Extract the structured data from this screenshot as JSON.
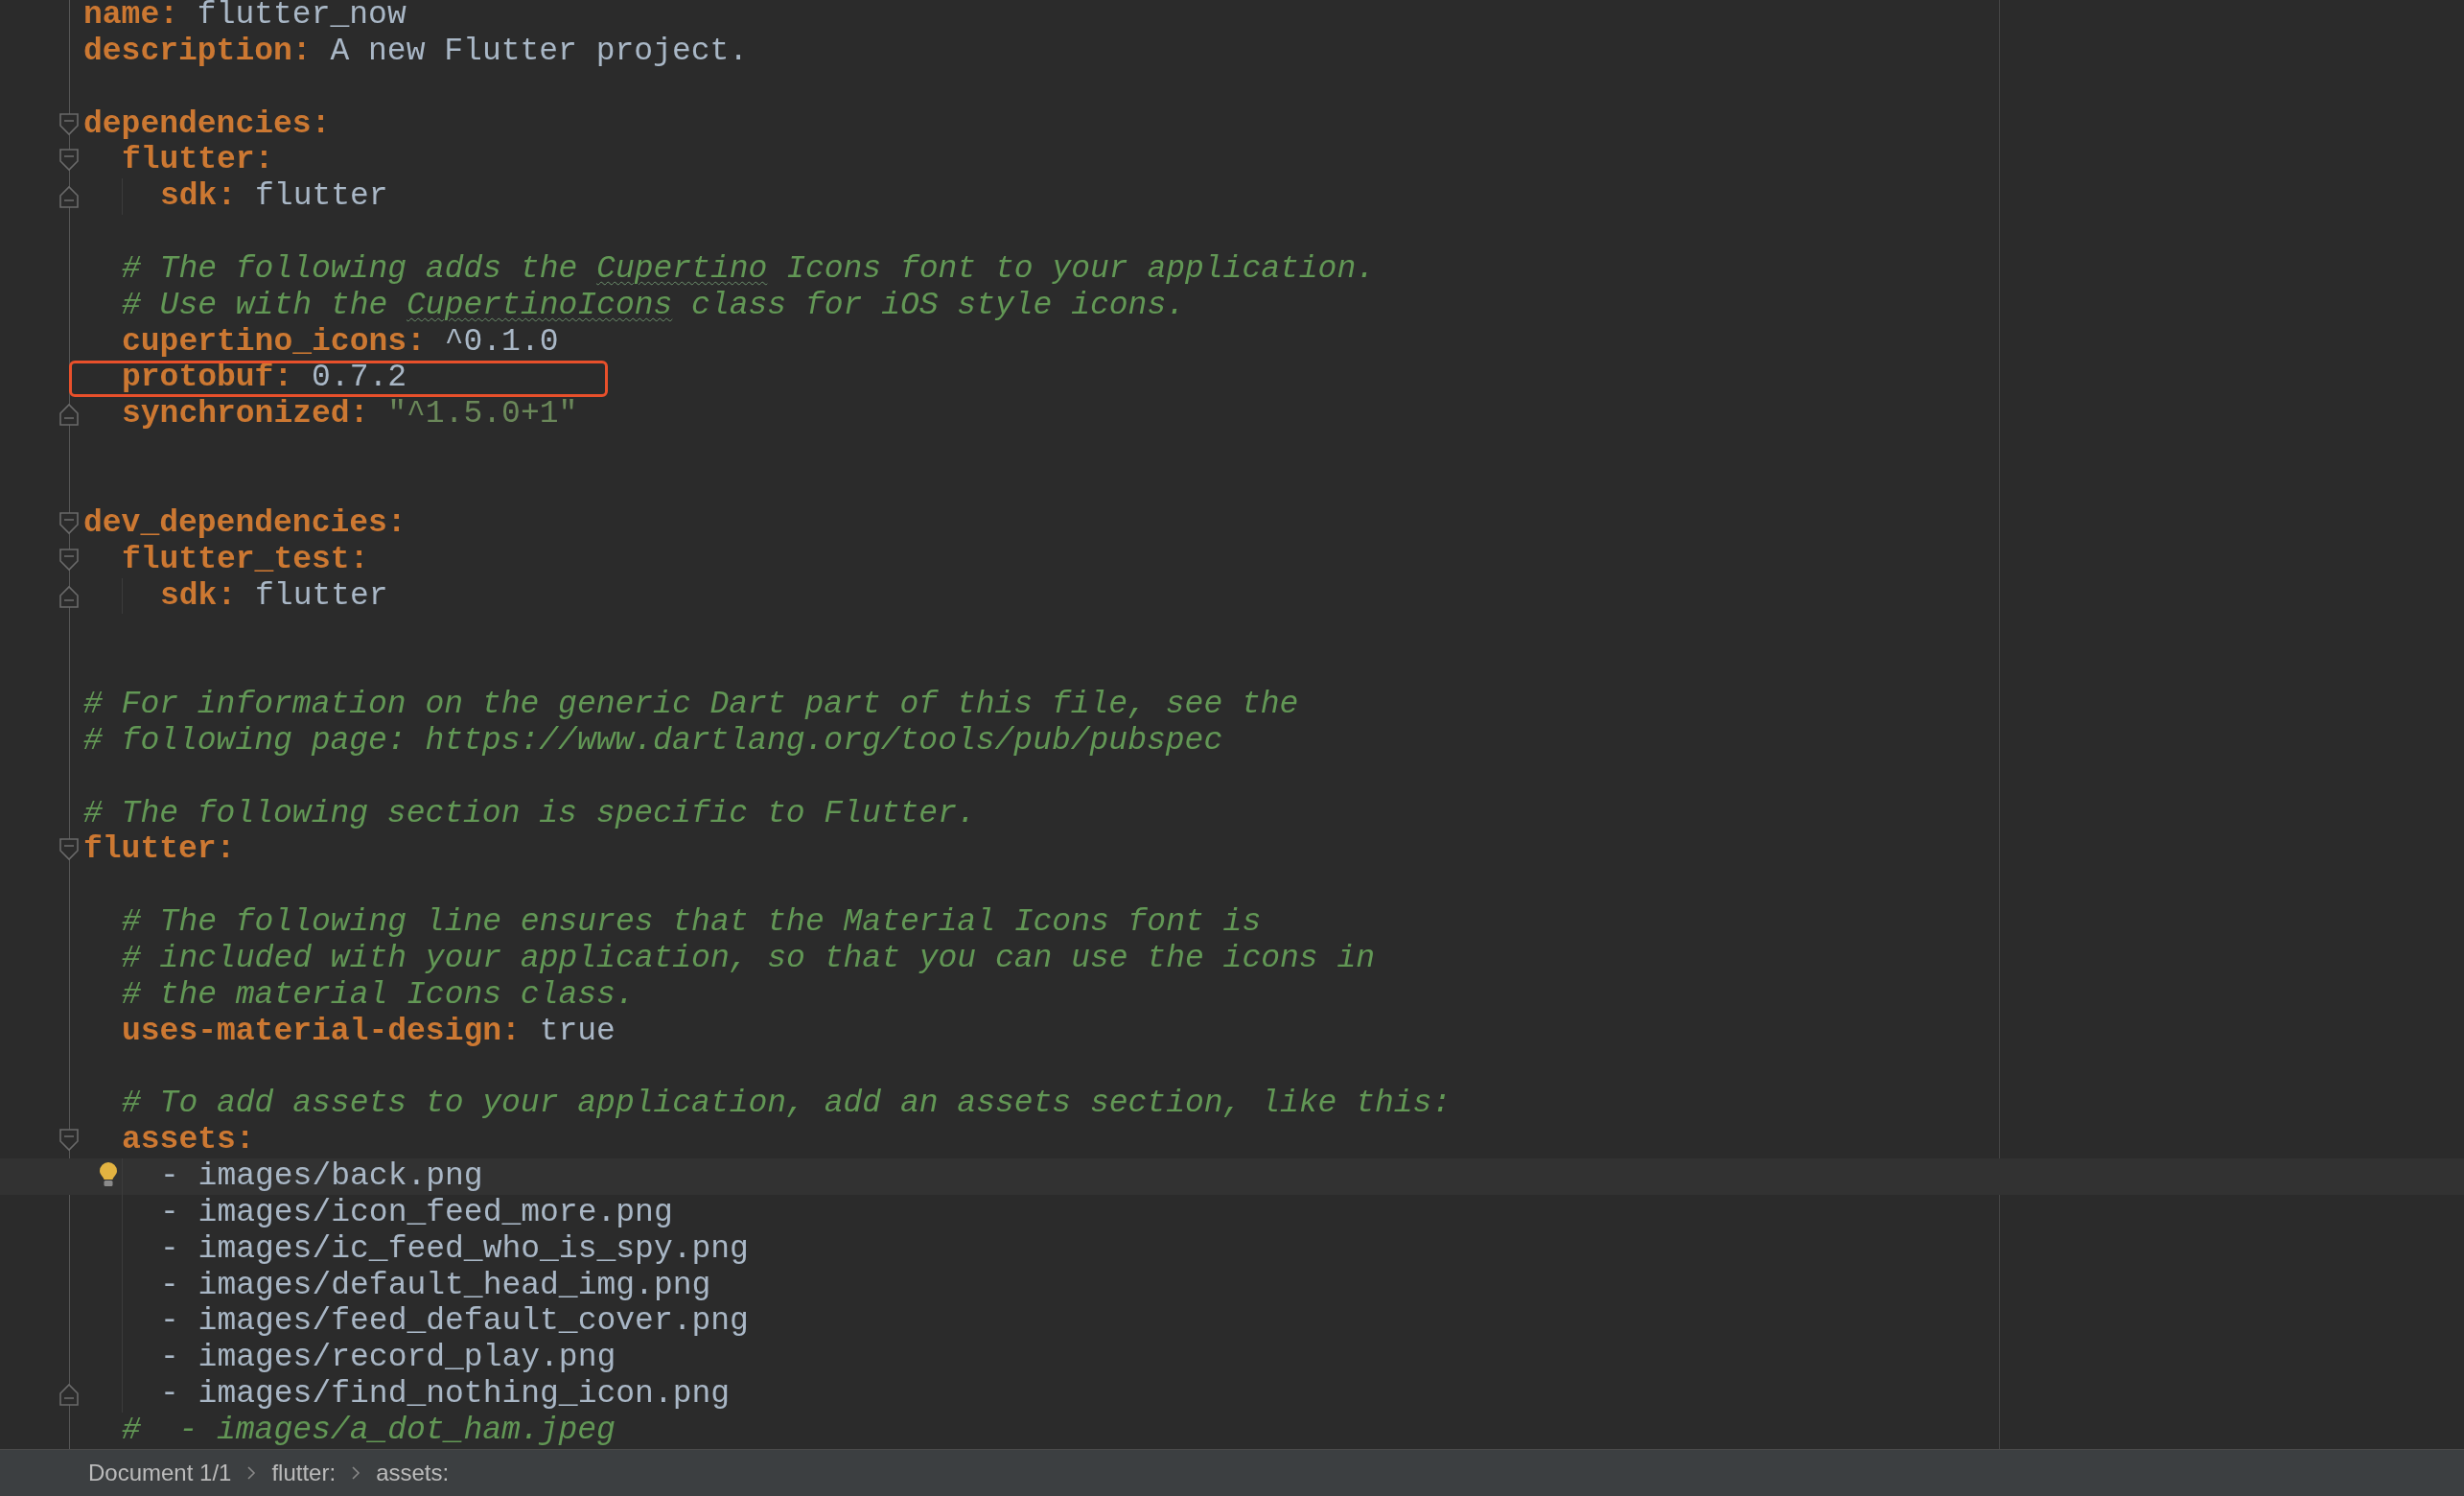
{
  "editor": {
    "lines": [
      {
        "kind": "pair",
        "key": "name:",
        "value": "flutter_now",
        "quoted": false
      },
      {
        "kind": "pair",
        "key": "description:",
        "value": "A new Flutter project.",
        "quoted": false
      },
      {
        "kind": "blank"
      },
      {
        "kind": "pair",
        "key": "dependencies:",
        "fold_start": true,
        "children": [
          {
            "kind": "pair",
            "key": "flutter:",
            "fold_start": true,
            "children": [
              {
                "kind": "pair",
                "key": "sdk:",
                "value": "flutter",
                "quoted": false,
                "fold_end": true
              }
            ]
          },
          {
            "kind": "blank"
          },
          {
            "kind": "comment",
            "segments": [
              {
                "text": "# The following adds the ",
                "typo": false
              },
              {
                "text": "Cupertino",
                "typo": true
              },
              {
                "text": " Icons font to your application.",
                "typo": false
              }
            ]
          },
          {
            "kind": "comment",
            "segments": [
              {
                "text": "# Use with the ",
                "typo": false
              },
              {
                "text": "CupertinoIcons",
                "typo": true
              },
              {
                "text": " class for iOS style icons.",
                "typo": false
              }
            ]
          },
          {
            "kind": "pair",
            "key": "cupertino_icons:",
            "value": "^0.1.0",
            "quoted": false
          },
          {
            "kind": "pair",
            "key": "protobuf:",
            "value": "0.7.2",
            "quoted": false,
            "highlighted": true
          },
          {
            "kind": "pair",
            "key": "synchronized:",
            "value": "\"^1.5.0+1\"",
            "quoted": true,
            "fold_end": true
          }
        ]
      },
      {
        "kind": "blank"
      },
      {
        "kind": "blank"
      },
      {
        "kind": "pair",
        "key": "dev_dependencies:",
        "fold_start": true,
        "children": [
          {
            "kind": "pair",
            "key": "flutter_test:",
            "fold_start": true,
            "children": [
              {
                "kind": "pair",
                "key": "sdk:",
                "value": "flutter",
                "quoted": false,
                "fold_end": true
              }
            ]
          }
        ]
      },
      {
        "kind": "blank"
      },
      {
        "kind": "blank"
      },
      {
        "kind": "comment",
        "segments": [
          {
            "text": "# For information on the generic Dart part of this file, see the",
            "typo": false
          }
        ]
      },
      {
        "kind": "comment",
        "segments": [
          {
            "text": "# following page: https://www.dartlang.org/tools/pub/pubspec",
            "typo": false
          }
        ]
      },
      {
        "kind": "blank"
      },
      {
        "kind": "comment",
        "segments": [
          {
            "text": "# The following section is specific to Flutter.",
            "typo": false
          }
        ]
      },
      {
        "kind": "pair",
        "key": "flutter:",
        "fold_start": true,
        "children": [
          {
            "kind": "blank"
          },
          {
            "kind": "comment",
            "segments": [
              {
                "text": "# The following line ensures that the Material Icons font is",
                "typo": false
              }
            ]
          },
          {
            "kind": "comment",
            "segments": [
              {
                "text": "# included with your application, so that you can use the icons in",
                "typo": false
              }
            ]
          },
          {
            "kind": "comment",
            "segments": [
              {
                "text": "# the material Icons class.",
                "typo": false
              }
            ]
          },
          {
            "kind": "pair",
            "key": "uses-material-design:",
            "value": "true",
            "quoted": false
          },
          {
            "kind": "blank"
          },
          {
            "kind": "comment",
            "segments": [
              {
                "text": "# To add assets to your application, add an assets section, like this:",
                "typo": false
              }
            ]
          },
          {
            "kind": "pair",
            "key": "assets:",
            "fold_start": true,
            "children": [
              {
                "kind": "item",
                "text": "- images/back.png",
                "current": true
              },
              {
                "kind": "item",
                "text": "- images/icon_feed_more.png",
                "current": false
              },
              {
                "kind": "item",
                "text": "- images/ic_feed_who_is_spy.png",
                "current": false
              },
              {
                "kind": "item",
                "text": "- images/default_head_img.png",
                "current": false
              },
              {
                "kind": "item",
                "text": "- images/feed_default_cover.png",
                "current": false
              },
              {
                "kind": "item",
                "text": "- images/record_play.png",
                "current": false
              },
              {
                "kind": "item",
                "text": "- images/find_nothing_icon.png",
                "current": false,
                "fold_end": true
              }
            ]
          },
          {
            "kind": "comment",
            "segments": [
              {
                "text": "#  - images/a_dot_ham.jpeg",
                "typo": false
              }
            ]
          }
        ]
      }
    ]
  },
  "status_bar": {
    "breadcrumbs": [
      "Document 1/1",
      "flutter:",
      "assets:"
    ]
  }
}
